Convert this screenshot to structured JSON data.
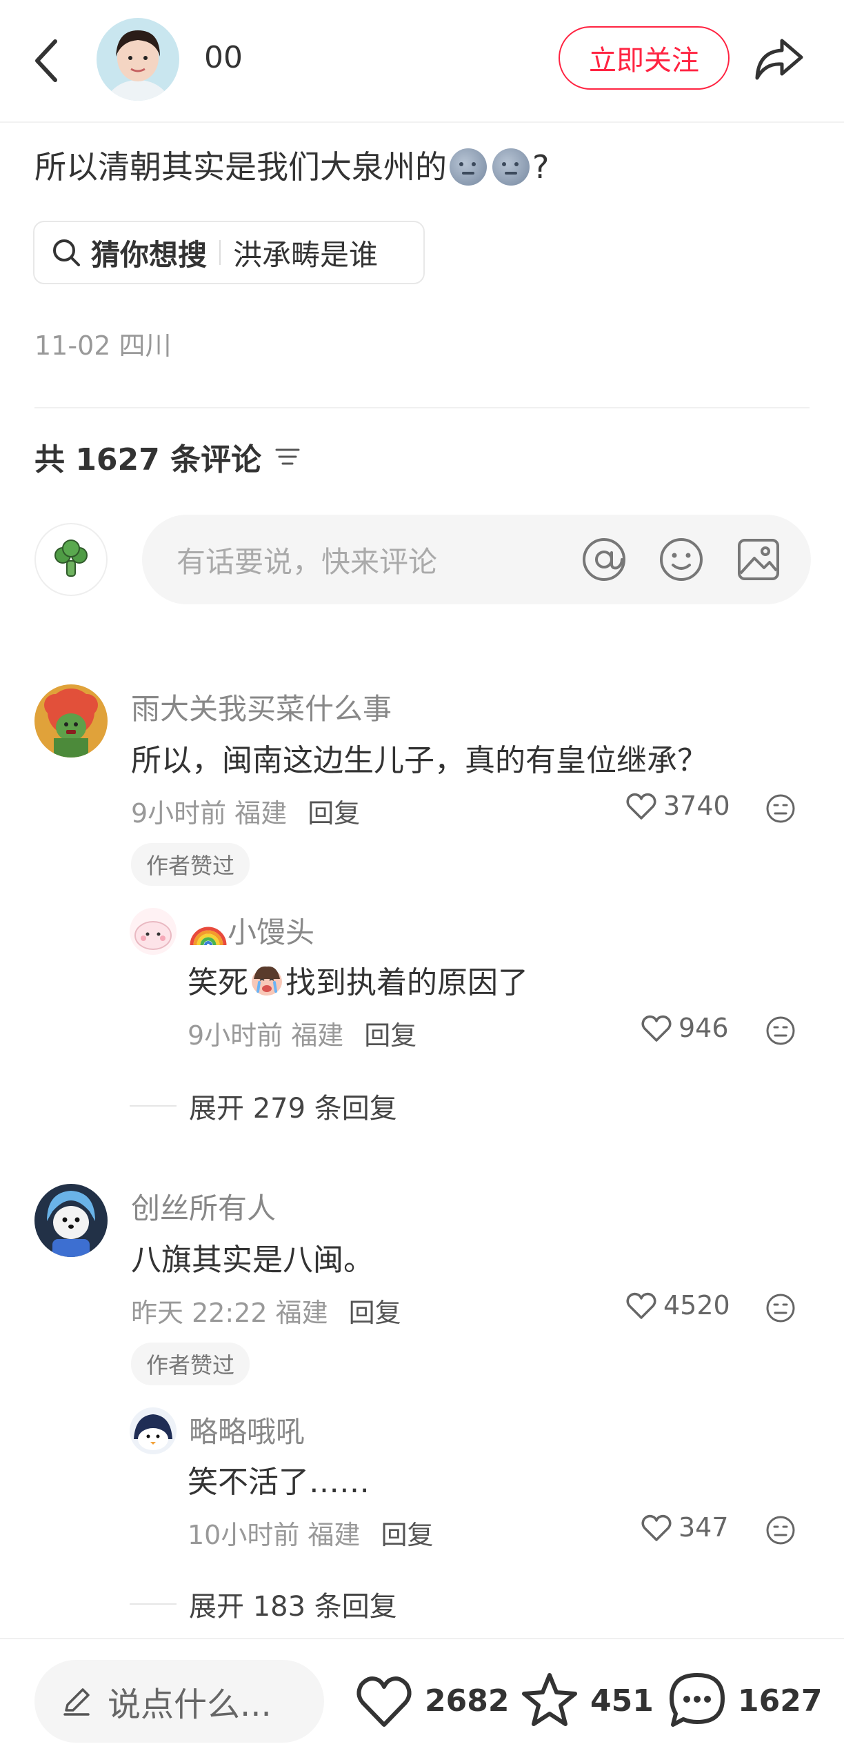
{
  "header": {
    "username": "00",
    "follow_label": "立即关注"
  },
  "post": {
    "title_text": "所以清朝其实是我们大泉州的",
    "title_suffix": "?",
    "search_chip_title": "猜你想搜",
    "search_chip_query": "洪承畴是谁",
    "meta": "11-02 四川"
  },
  "comments_header": {
    "count_label": "共 1627 条评论"
  },
  "comment_input": {
    "placeholder": "有话要说，快来评论"
  },
  "comments": [
    {
      "user": "雨大关我买菜什么事",
      "text": "所以，闽南这边生儿子，真的有皇位继承？",
      "time_location": "9小时前 福建",
      "reply_label": "回复",
      "likes": "3740",
      "badge": "作者赞过",
      "sub_reply": {
        "user": "小馒头",
        "text_before": "笑死",
        "text_after": "找到执着的原因了",
        "time_location": "9小时前 福建",
        "reply_label": "回复",
        "likes": "946"
      },
      "expand_label": "展开 279 条回复"
    },
    {
      "user": "创丝所有人",
      "text": "八旗其实是八闽。",
      "time_location": "昨天 22:22 福建",
      "reply_label": "回复",
      "likes": "4520",
      "badge": "作者赞过",
      "sub_reply": {
        "user": "略略哦吼",
        "text": "笑不活了……",
        "time_location": "10小时前 福建",
        "reply_label": "回复",
        "likes": "347"
      },
      "expand_label": "展开 183 条回复"
    }
  ],
  "bottom_bar": {
    "input_placeholder": "说点什么...",
    "likes": "2682",
    "stars": "451",
    "comments": "1627"
  },
  "colors": {
    "accent": "#ff2442",
    "text": "#333333",
    "secondary_text": "#999999"
  }
}
